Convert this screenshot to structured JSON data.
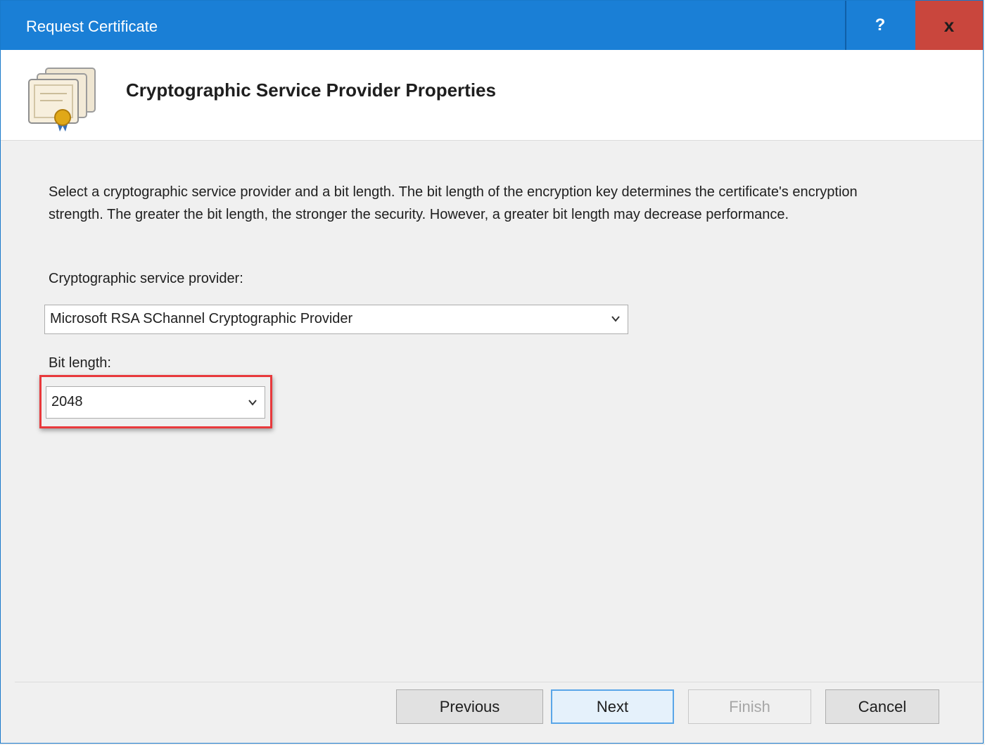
{
  "window": {
    "title": "Request Certificate",
    "help_label": "?",
    "close_label": "x"
  },
  "header": {
    "title": "Cryptographic Service Provider Properties",
    "icon": "certificate-icon"
  },
  "main": {
    "description": "Select a cryptographic service provider and a bit length. The bit length of the encryption key determines the certificate's encryption strength. The greater the bit length, the stronger the security. However, a greater bit length may decrease performance.",
    "provider_label": "Cryptographic service provider:",
    "provider_value": "Microsoft RSA SChannel Cryptographic Provider",
    "bit_length_label": "Bit length:",
    "bit_length_value": "2048"
  },
  "buttons": {
    "previous": "Previous",
    "next": "Next",
    "finish": "Finish",
    "cancel": "Cancel"
  },
  "colors": {
    "titlebar": "#1a7fd6",
    "close": "#c9463d",
    "highlight": "#e8393c"
  }
}
